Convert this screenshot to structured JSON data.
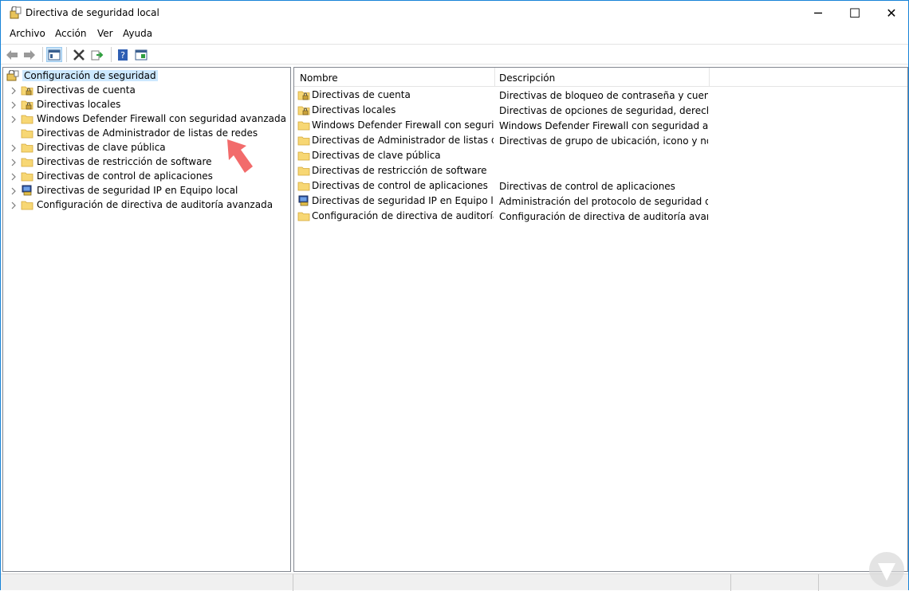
{
  "window": {
    "title": "Directiva de seguridad local",
    "controls": {
      "minimize": "─",
      "maximize": "☐",
      "close": "✕"
    }
  },
  "menu": [
    "Archivo",
    "Acción",
    "Ver",
    "Ayuda"
  ],
  "toolbar": {
    "icons": [
      "back-icon",
      "forward-icon",
      "show-hide-tree-icon",
      "delete-icon",
      "export-list-icon",
      "help-icon",
      "properties-icon"
    ]
  },
  "tree": {
    "root": {
      "label": "Configuración de seguridad",
      "icon": "security-settings-icon"
    },
    "items": [
      {
        "label": "Directivas de cuenta",
        "icon": "locked-folder-icon",
        "expandable": true
      },
      {
        "label": "Directivas locales",
        "icon": "locked-folder-icon",
        "expandable": true
      },
      {
        "label": "Windows Defender Firewall con seguridad avanzada",
        "icon": "folder-icon",
        "expandable": true
      },
      {
        "label": "Directivas de Administrador de listas de redes",
        "icon": "folder-icon",
        "expandable": false
      },
      {
        "label": "Directivas de clave pública",
        "icon": "folder-icon",
        "expandable": true
      },
      {
        "label": "Directivas de restricción de software",
        "icon": "folder-icon",
        "expandable": true
      },
      {
        "label": "Directivas de control de aplicaciones",
        "icon": "folder-icon",
        "expandable": true
      },
      {
        "label": "Directivas de seguridad IP en Equipo local",
        "icon": "ip-security-icon",
        "expandable": true
      },
      {
        "label": "Configuración de directiva de auditoría avanzada",
        "icon": "folder-icon",
        "expandable": true
      }
    ]
  },
  "list": {
    "columns": [
      "Nombre",
      "Descripción"
    ],
    "rows": [
      {
        "name": "Directivas de cuenta",
        "desc": "Directivas de bloqueo de contraseña y cuenta",
        "icon": "locked-folder-icon"
      },
      {
        "name": "Directivas locales",
        "desc": "Directivas de opciones de seguridad, derechos ...",
        "icon": "locked-folder-icon"
      },
      {
        "name": "Windows Defender Firewall con segurida...",
        "desc": "Windows Defender Firewall con seguridad avan...",
        "icon": "folder-icon"
      },
      {
        "name": "Directivas de Administrador de listas de r...",
        "desc": "Directivas de grupo de ubicación, icono y nom...",
        "icon": "folder-icon"
      },
      {
        "name": "Directivas de clave pública",
        "desc": "",
        "icon": "folder-icon"
      },
      {
        "name": "Directivas de restricción de software",
        "desc": "",
        "icon": "folder-icon"
      },
      {
        "name": "Directivas de control de aplicaciones",
        "desc": "Directivas de control de aplicaciones",
        "icon": "folder-icon"
      },
      {
        "name": "Directivas de seguridad IP en Equipo local",
        "desc": "Administración del protocolo de seguridad de I...",
        "icon": "ip-security-icon"
      },
      {
        "name": "Configuración de directiva de auditoría a...",
        "desc": "Configuración de directiva de auditoría avanzada",
        "icon": "folder-icon"
      }
    ]
  },
  "colors": {
    "selection": "#cce8ff",
    "folder": "#f7d774",
    "arrow": "#f26b6b",
    "accent": "#1883d7"
  }
}
